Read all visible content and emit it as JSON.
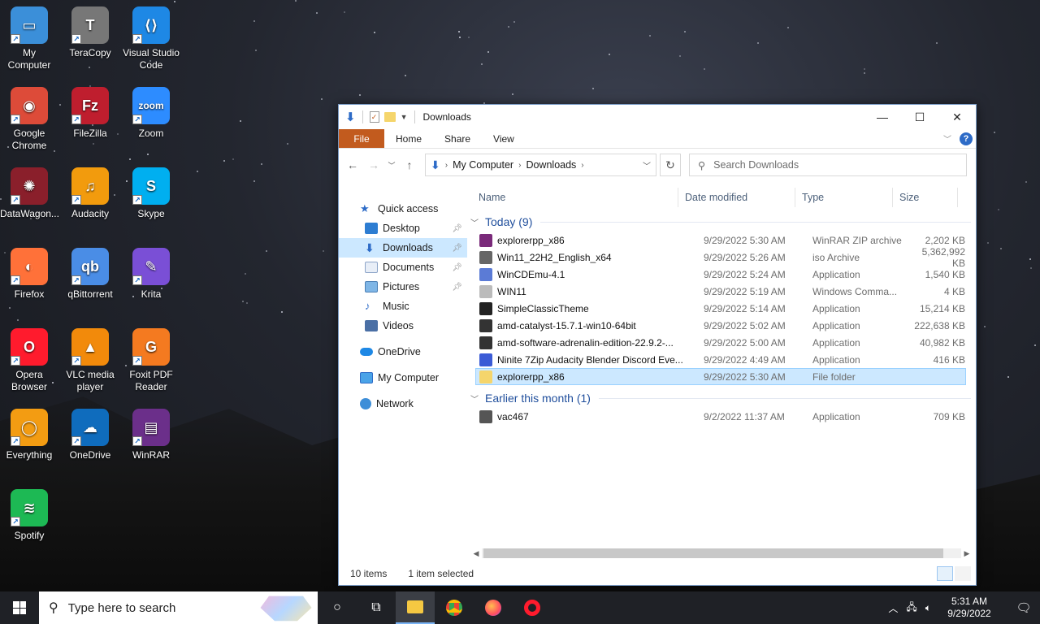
{
  "desktop_icons": [
    {
      "label": "My Computer",
      "icon": "monitor-icon"
    },
    {
      "label": "TeraCopy",
      "icon": "teracopy-icon"
    },
    {
      "label": "Visual Studio Code",
      "icon": "vscode-icon"
    },
    {
      "label": "Google Chrome",
      "icon": "chrome-icon"
    },
    {
      "label": "FileZilla",
      "icon": "filezilla-icon"
    },
    {
      "label": "Zoom",
      "icon": "zoom-icon"
    },
    {
      "label": "DataWagon...",
      "icon": "datawagon-icon"
    },
    {
      "label": "Audacity",
      "icon": "audacity-icon"
    },
    {
      "label": "Skype",
      "icon": "skype-icon"
    },
    {
      "label": "Firefox",
      "icon": "firefox-icon"
    },
    {
      "label": "qBittorrent",
      "icon": "qbittorrent-icon"
    },
    {
      "label": "Krita",
      "icon": "krita-icon"
    },
    {
      "label": "Opera Browser",
      "icon": "opera-icon"
    },
    {
      "label": "VLC media player",
      "icon": "vlc-icon"
    },
    {
      "label": "Foxit PDF Reader",
      "icon": "foxit-icon"
    },
    {
      "label": "Everything",
      "icon": "everything-icon"
    },
    {
      "label": "OneDrive",
      "icon": "onedrive-icon"
    },
    {
      "label": "WinRAR",
      "icon": "winrar-icon"
    },
    {
      "label": "Spotify",
      "icon": "spotify-icon"
    }
  ],
  "window": {
    "title": "Downloads",
    "ribbon": {
      "file": "File",
      "home": "Home",
      "share": "Share",
      "view": "View",
      "help": "?"
    },
    "address": {
      "root": "My Computer",
      "current": "Downloads"
    },
    "search": {
      "placeholder": "Search Downloads"
    },
    "nav": {
      "quick_access": "Quick access",
      "desktop": "Desktop",
      "downloads": "Downloads",
      "documents": "Documents",
      "pictures": "Pictures",
      "music": "Music",
      "videos": "Videos",
      "onedrive": "OneDrive",
      "my_computer": "My Computer",
      "network": "Network"
    },
    "columns": {
      "name": "Name",
      "date": "Date modified",
      "type": "Type",
      "size": "Size"
    },
    "groups": {
      "today": {
        "label": "Today (9)",
        "files": [
          {
            "name": "explorerpp_x86",
            "date": "9/29/2022 5:30 AM",
            "type": "WinRAR ZIP archive",
            "size": "2,202 KB",
            "icon_color": "#7a2a7a"
          },
          {
            "name": "Win11_22H2_English_x64",
            "date": "9/29/2022 5:26 AM",
            "type": "iso Archive",
            "size": "5,362,992 KB",
            "icon_color": "#666666"
          },
          {
            "name": "WinCDEmu-4.1",
            "date": "9/29/2022 5:24 AM",
            "type": "Application",
            "size": "1,540 KB",
            "icon_color": "#5b7bd6"
          },
          {
            "name": "WIN11",
            "date": "9/29/2022 5:19 AM",
            "type": "Windows Comma...",
            "size": "4 KB",
            "icon_color": "#bbbbbb"
          },
          {
            "name": "SimpleClassicTheme",
            "date": "9/29/2022 5:14 AM",
            "type": "Application",
            "size": "15,214 KB",
            "icon_color": "#222222"
          },
          {
            "name": "amd-catalyst-15.7.1-win10-64bit",
            "date": "9/29/2022 5:02 AM",
            "type": "Application",
            "size": "222,638 KB",
            "icon_color": "#333333"
          },
          {
            "name": "amd-software-adrenalin-edition-22.9.2-...",
            "date": "9/29/2022 5:00 AM",
            "type": "Application",
            "size": "40,982 KB",
            "icon_color": "#333333"
          },
          {
            "name": "Ninite 7Zip Audacity Blender Discord Eve...",
            "date": "9/29/2022 4:49 AM",
            "type": "Application",
            "size": "416 KB",
            "icon_color": "#3b5bd6"
          },
          {
            "name": "explorerpp_x86",
            "date": "9/29/2022 5:30 AM",
            "type": "File folder",
            "size": "",
            "icon_color": "#f5d56b"
          }
        ]
      },
      "earlier": {
        "label": "Earlier this month (1)",
        "files": [
          {
            "name": "vac467",
            "date": "9/2/2022 11:37 AM",
            "type": "Application",
            "size": "709 KB",
            "icon_color": "#555555"
          }
        ]
      }
    },
    "status": {
      "items": "10 items",
      "selected": "1 item selected"
    }
  },
  "taskbar": {
    "search_placeholder": "Type here to search",
    "time": "5:31 AM",
    "date": "9/29/2022"
  }
}
